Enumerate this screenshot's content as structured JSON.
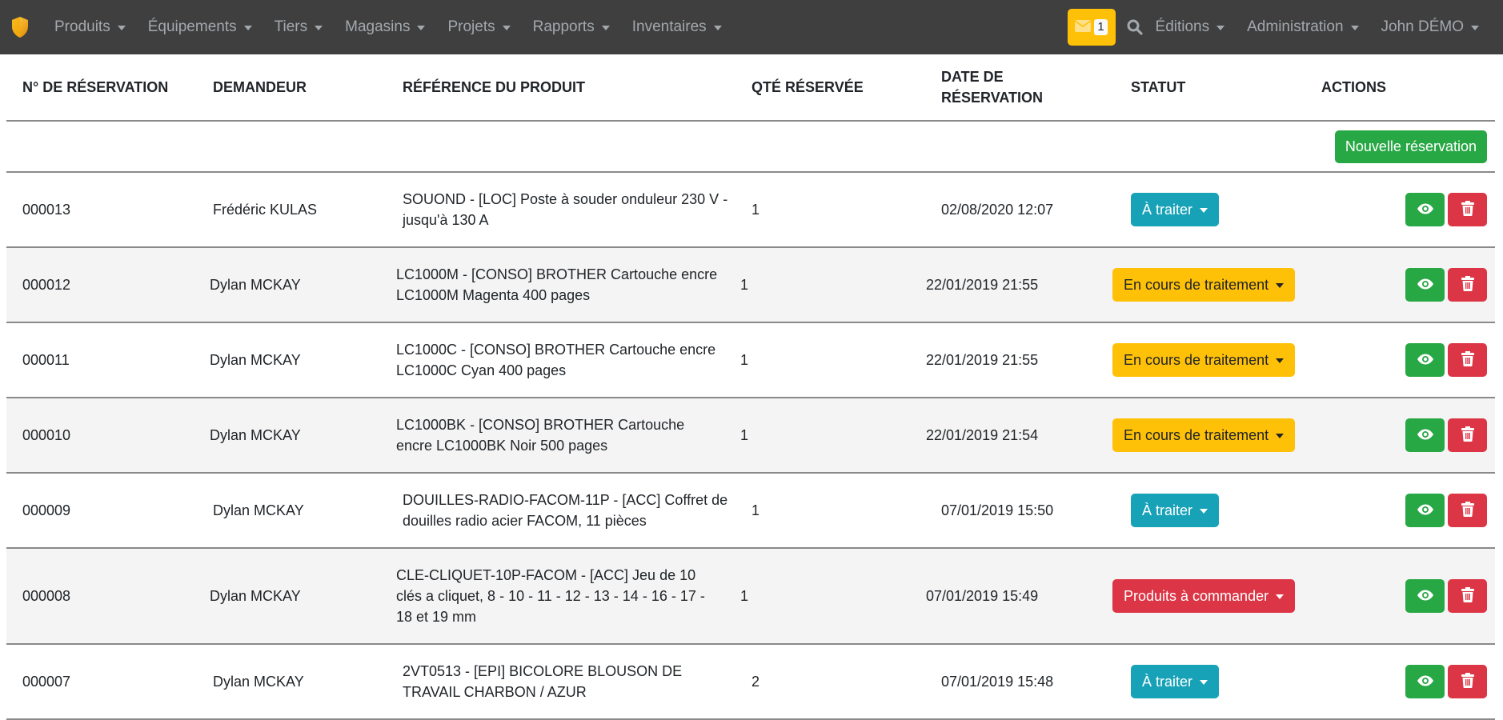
{
  "navbar": {
    "brand_icon": "shield-icon",
    "menu": [
      {
        "label": "Produits"
      },
      {
        "label": "Équipements"
      },
      {
        "label": "Tiers"
      },
      {
        "label": "Magasins"
      },
      {
        "label": "Projets"
      },
      {
        "label": "Rapports"
      },
      {
        "label": "Inventaires"
      }
    ],
    "messages": {
      "icon": "envelope-icon",
      "count": "1"
    },
    "search_icon": "search-icon",
    "right_menu": [
      {
        "label": "Éditions"
      },
      {
        "label": "Administration"
      },
      {
        "label": "John DÉMO"
      }
    ]
  },
  "table": {
    "headers": {
      "number": "N° DE RÉSERVATION",
      "requester": "DEMANDEUR",
      "product": "RÉFÉRENCE DU PRODUIT",
      "quantity": "QTÉ RÉSERVÉE",
      "date_line1": "DATE DE",
      "date_line2": "RÉSERVATION",
      "status": "STATUT",
      "actions": "ACTIONS"
    },
    "new_button": "Nouvelle réservation",
    "rows": [
      {
        "number": "000013",
        "requester": "Frédéric KULAS",
        "product": "SOUOND - [LOC] Poste à souder onduleur 230 V - jusqu'à 130 A",
        "quantity": "1",
        "date": "02/08/2020 12:07",
        "status": "À traiter",
        "status_type": "info"
      },
      {
        "number": "000012",
        "requester": "Dylan MCKAY",
        "product": "LC1000M - [CONSO] BROTHER Cartouche encre LC1000M Magenta 400 pages",
        "quantity": "1",
        "date": "22/01/2019 21:55",
        "status": "En cours de traitement",
        "status_type": "warning"
      },
      {
        "number": "000011",
        "requester": "Dylan MCKAY",
        "product": "LC1000C - [CONSO] BROTHER Cartouche encre LC1000C Cyan 400 pages",
        "quantity": "1",
        "date": "22/01/2019 21:55",
        "status": "En cours de traitement",
        "status_type": "warning"
      },
      {
        "number": "000010",
        "requester": "Dylan MCKAY",
        "product": "LC1000BK - [CONSO] BROTHER Cartouche encre LC1000BK Noir 500 pages",
        "quantity": "1",
        "date": "22/01/2019 21:54",
        "status": "En cours de traitement",
        "status_type": "warning"
      },
      {
        "number": "000009",
        "requester": "Dylan MCKAY",
        "product": "DOUILLES-RADIO-FACOM-11P - [ACC] Coffret de douilles radio acier FACOM, 11 pièces",
        "quantity": "1",
        "date": "07/01/2019 15:50",
        "status": "À traiter",
        "status_type": "info"
      },
      {
        "number": "000008",
        "requester": "Dylan MCKAY",
        "product": "CLE-CLIQUET-10P-FACOM - [ACC] Jeu de 10 clés a cliquet, 8 - 10 - 11 - 12 - 13 - 14 - 16 - 17 - 18 et 19 mm",
        "quantity": "1",
        "date": "07/01/2019 15:49",
        "status": "Produits à commander",
        "status_type": "danger"
      },
      {
        "number": "000007",
        "requester": "Dylan MCKAY",
        "product": "2VT0513 - [EPI] BICOLORE BLOUSON DE TRAVAIL CHARBON / AZUR",
        "quantity": "2",
        "date": "07/01/2019 15:48",
        "status": "À traiter",
        "status_type": "info"
      }
    ],
    "view_icon": "eye-icon",
    "delete_icon": "trash-icon"
  },
  "colors": {
    "navbar_bg": "#3f3f3f",
    "info": "#17a2b8",
    "warning": "#ffc107",
    "danger": "#dc3545",
    "success": "#28a745"
  }
}
